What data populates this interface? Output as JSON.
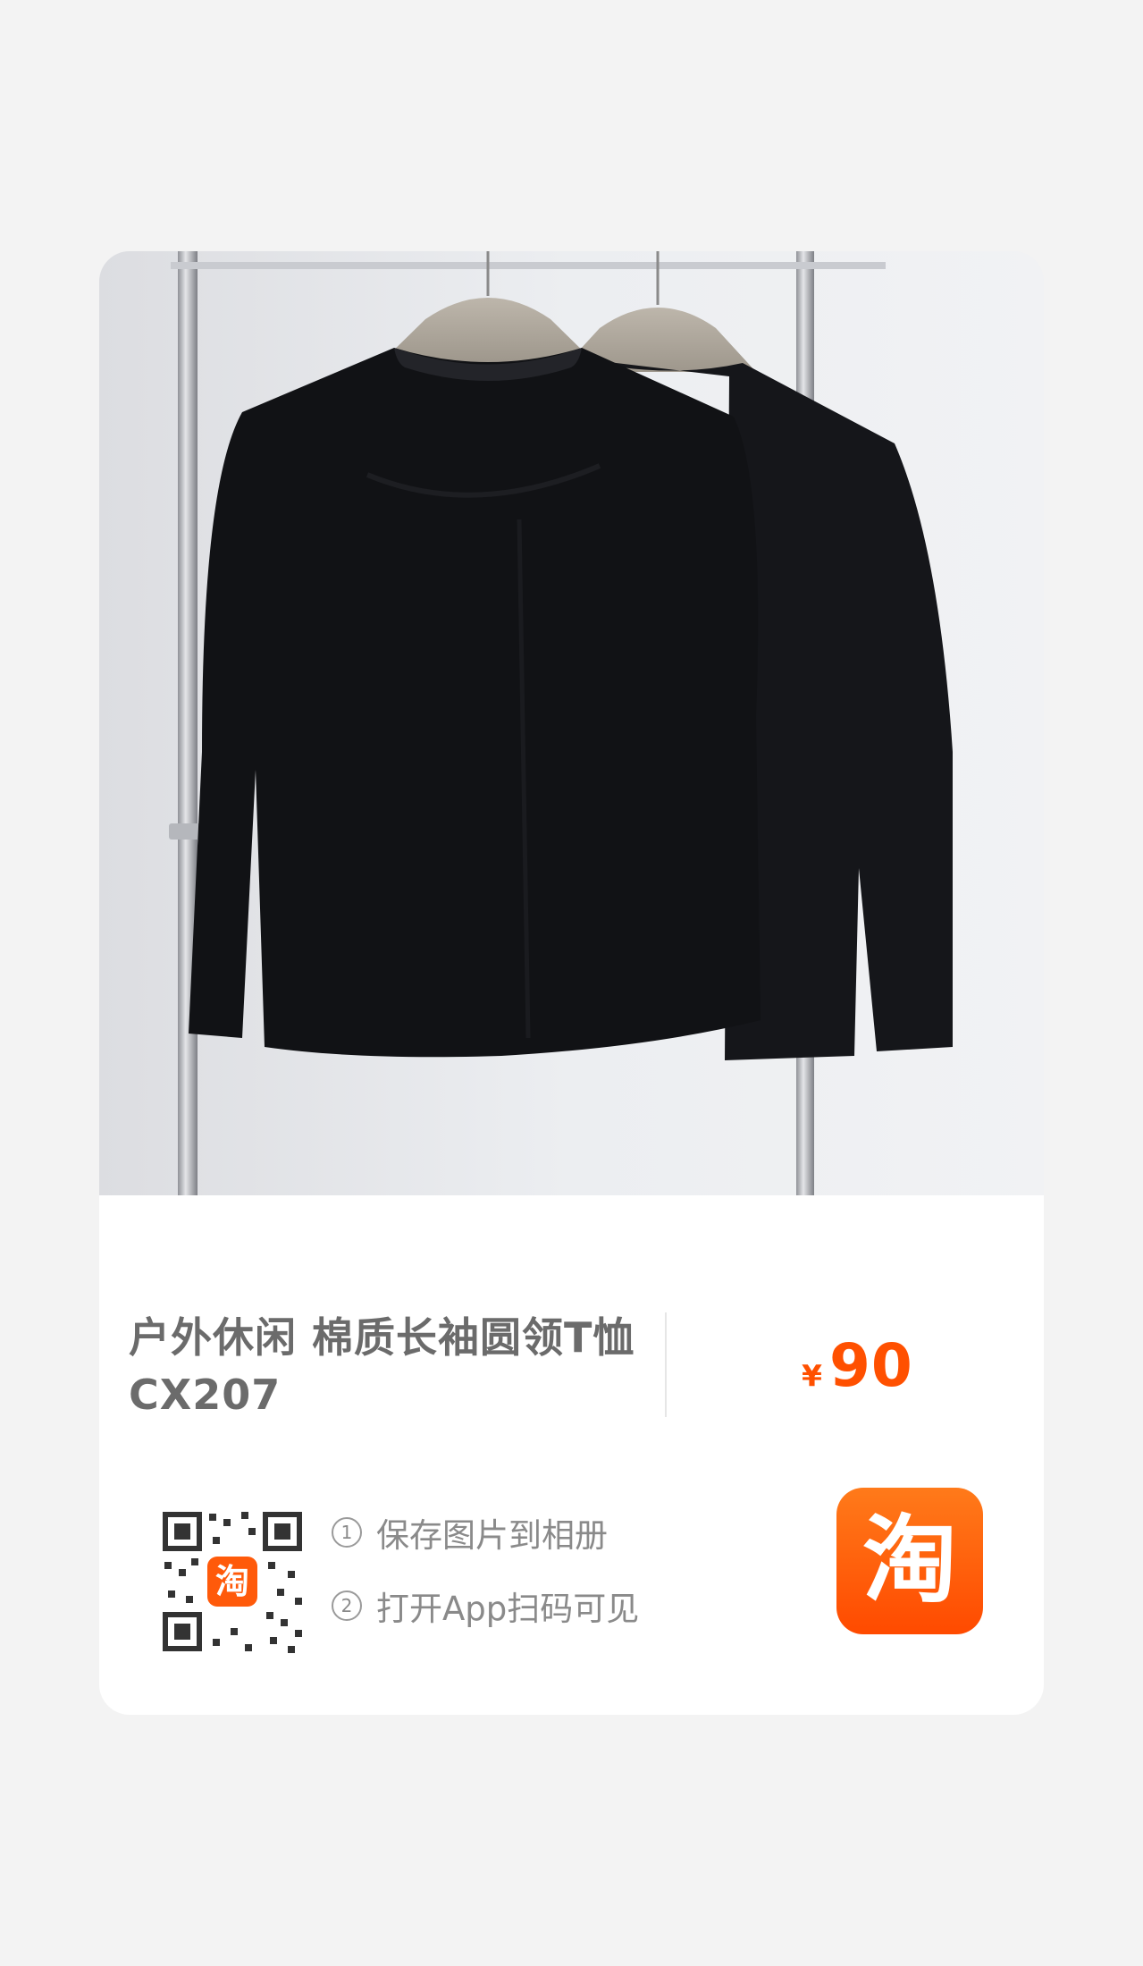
{
  "product": {
    "title_line1": "户外休闲 棉质长袖圆领T恤",
    "title_line2": "CX207",
    "price_currency": "¥",
    "price_value": "90"
  },
  "instructions": [
    {
      "num": "1",
      "text": "保存图片到相册"
    },
    {
      "num": "2",
      "text": "打开App扫码可见"
    }
  ],
  "brand": {
    "logo_text": "淘",
    "qr_logo_text": "淘",
    "accent_color": "#ff5000"
  },
  "icons": {
    "qr": "qr-code-icon",
    "logo": "taobao-logo-icon"
  }
}
